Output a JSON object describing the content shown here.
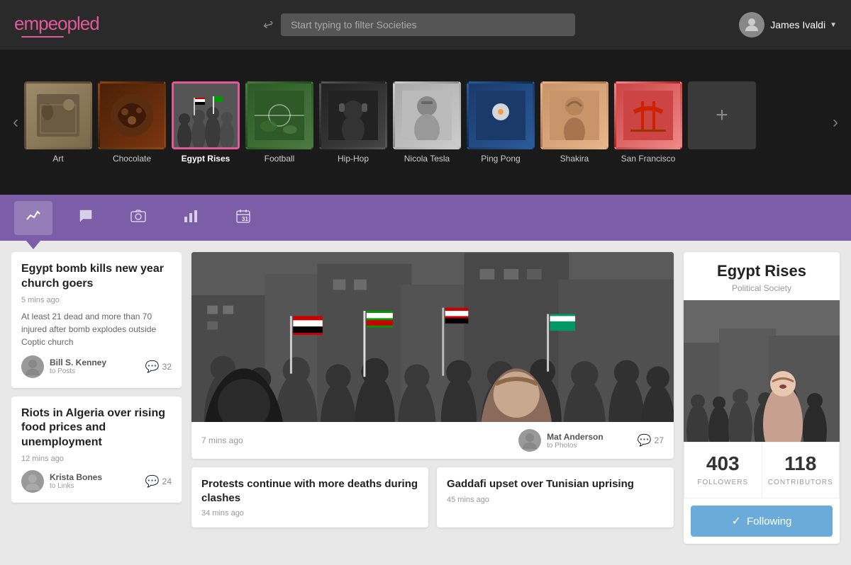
{
  "header": {
    "logo_text": "em",
    "logo_bold": "peopled",
    "search_placeholder": "Start typing to filter Societies",
    "user_name": "James Ivaldi"
  },
  "societies": {
    "items": [
      {
        "id": "art",
        "label": "Art",
        "bg_class": "bg-art",
        "active": false
      },
      {
        "id": "chocolate",
        "label": "Chocolate",
        "bg_class": "bg-chocolate",
        "active": false
      },
      {
        "id": "egypt",
        "label": "Egypt Rises",
        "bg_class": "bg-egypt",
        "active": true
      },
      {
        "id": "football",
        "label": "Football",
        "bg_class": "bg-football",
        "active": false
      },
      {
        "id": "hiphop",
        "label": "Hip-Hop",
        "bg_class": "bg-hiphop",
        "active": false
      },
      {
        "id": "tesla",
        "label": "Nicola Tesla",
        "bg_class": "bg-tesla",
        "active": false
      },
      {
        "id": "pingpong",
        "label": "Ping Pong",
        "bg_class": "bg-pingpong",
        "active": false
      },
      {
        "id": "shakira",
        "label": "Shakira",
        "bg_class": "bg-shakira",
        "active": false
      },
      {
        "id": "sanfran",
        "label": "San Francisco",
        "bg_class": "bg-sanfran",
        "active": false
      }
    ],
    "add_label": "+"
  },
  "tabs": [
    {
      "id": "feed",
      "icon": "📈",
      "label": "Feed",
      "active": true
    },
    {
      "id": "chat",
      "icon": "💬",
      "label": "Chat",
      "active": false
    },
    {
      "id": "photos",
      "icon": "📷",
      "label": "Photos",
      "active": false
    },
    {
      "id": "stats",
      "icon": "📊",
      "label": "Stats",
      "active": false
    },
    {
      "id": "calendar",
      "icon": "📅",
      "label": "Calendar",
      "active": false
    }
  ],
  "left_news": [
    {
      "title": "Egypt bomb kills new year church goers",
      "time": "5 mins ago",
      "excerpt": "At least 21 dead and more than 70 injured after bomb explodes outside Coptic church",
      "author_name": "Bill S. Kenney",
      "author_sub": "to Posts",
      "comment_count": "32"
    },
    {
      "title": "Riots in Algeria over rising food prices and unemployment",
      "time": "12 mins ago",
      "excerpt": "",
      "author_name": "Krista Bones",
      "author_sub": "to Links",
      "comment_count": "24"
    }
  ],
  "main_post": {
    "time": "7 mins ago",
    "author_name": "Mat Anderson",
    "author_sub": "to Photos",
    "comment_count": "27"
  },
  "small_cards": [
    {
      "title": "Protests continue with more deaths during clashes",
      "time": "34 mins ago"
    },
    {
      "title": "Gaddafi upset over Tunisian uprising",
      "time": "45 mins ago"
    }
  ],
  "society_panel": {
    "name": "Egypt Rises",
    "type": "Political Society",
    "followers_count": "403",
    "followers_label": "FOLLOWERS",
    "contributors_count": "118",
    "contributors_label": "CONTRIBUTORS",
    "following_button": "Following"
  }
}
